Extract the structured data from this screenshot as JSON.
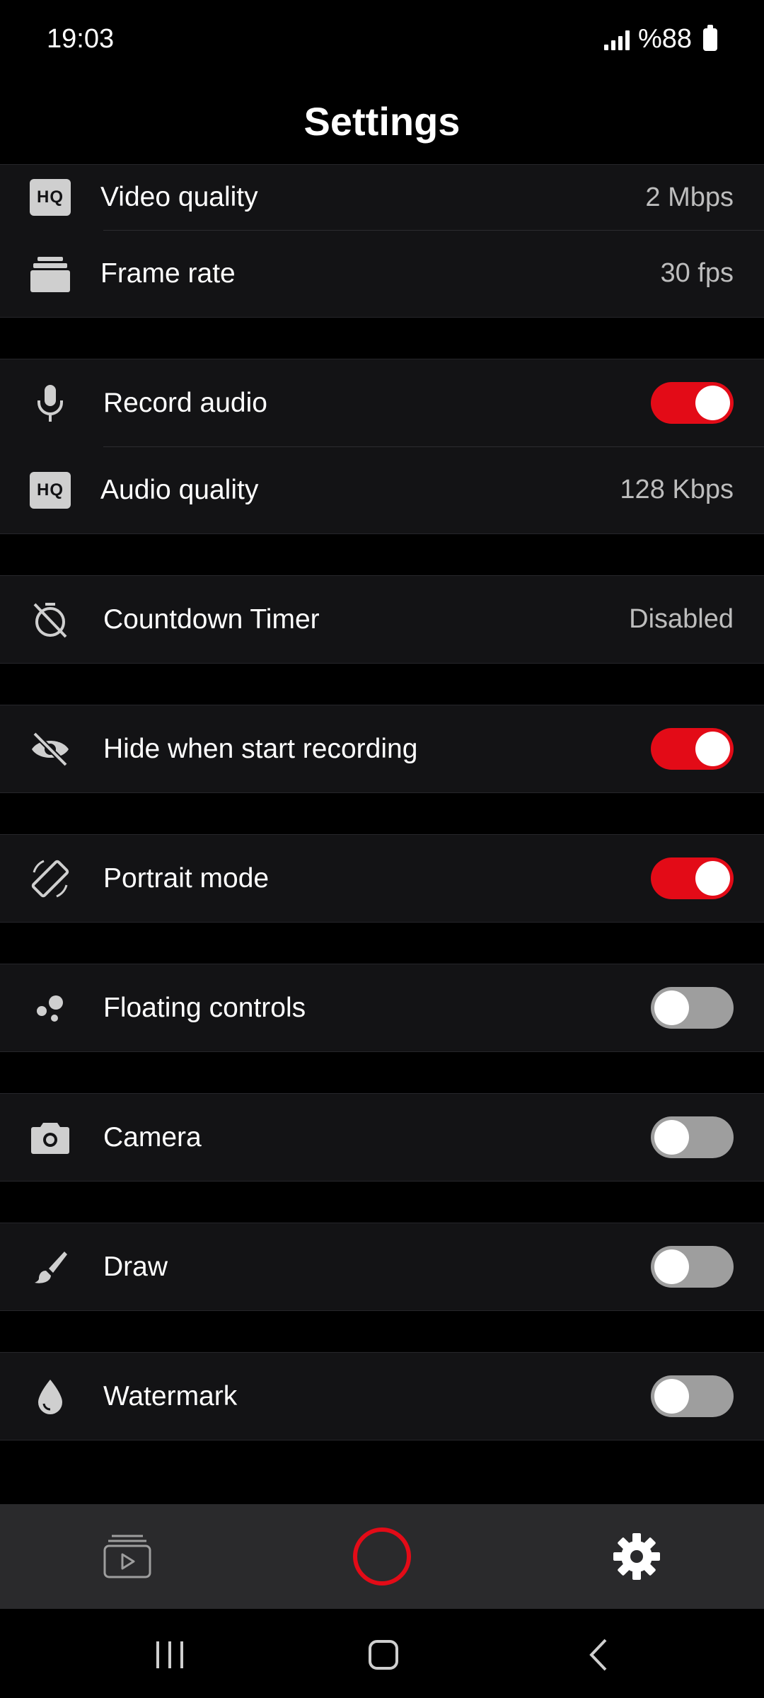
{
  "status_bar": {
    "time": "19:03",
    "battery": "%88"
  },
  "header": {
    "title": "Settings"
  },
  "settings": {
    "video_quality": {
      "label": "Video quality",
      "value": "2 Mbps",
      "icon": "hq-icon"
    },
    "frame_rate": {
      "label": "Frame rate",
      "value": "30 fps",
      "icon": "layers-icon"
    },
    "record_audio": {
      "label": "Record audio",
      "on": true,
      "icon": "microphone-icon"
    },
    "audio_quality": {
      "label": "Audio quality",
      "value": "128 Kbps",
      "icon": "hq-icon"
    },
    "countdown_timer": {
      "label": "Countdown Timer",
      "value": "Disabled",
      "icon": "timer-off-icon"
    },
    "hide_when_recording": {
      "label": "Hide when start recording",
      "on": true,
      "icon": "eye-off-icon"
    },
    "portrait_mode": {
      "label": "Portrait mode",
      "on": true,
      "icon": "screen-rotation-icon"
    },
    "floating_controls": {
      "label": "Floating controls",
      "on": false,
      "icon": "bubbles-icon"
    },
    "camera": {
      "label": "Camera",
      "on": false,
      "icon": "camera-icon"
    },
    "draw": {
      "label": "Draw",
      "on": false,
      "icon": "brush-icon"
    },
    "watermark": {
      "label": "Watermark",
      "on": false,
      "icon": "drop-icon"
    }
  },
  "hq_badge_text": "HQ",
  "colors": {
    "accent": "#e30b17",
    "toggle_off": "#9e9e9e",
    "row_bg": "#131315",
    "nav_bg": "#2a2a2c"
  }
}
